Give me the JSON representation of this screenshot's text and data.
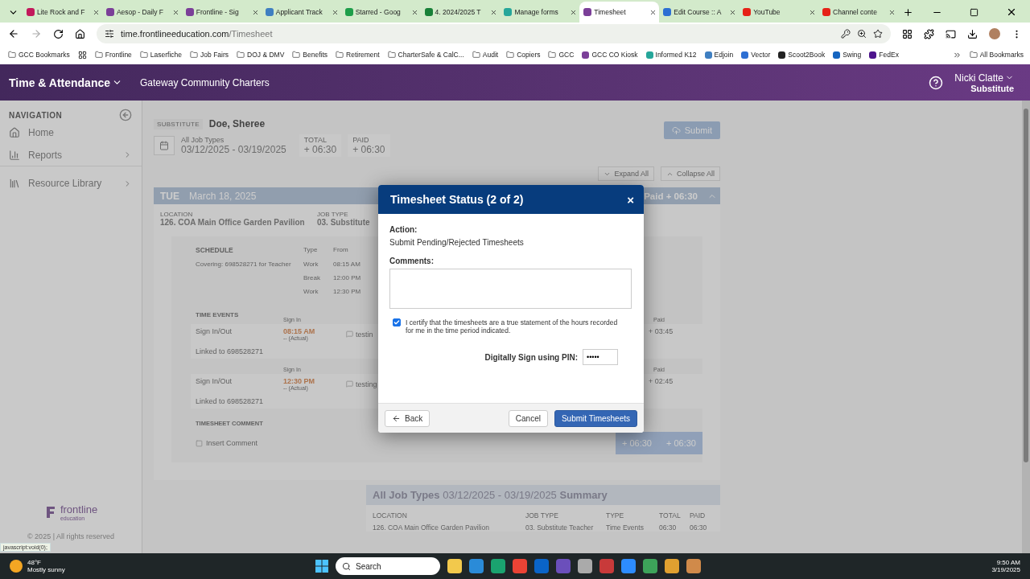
{
  "browser": {
    "tabs": [
      {
        "title": "Lite Rock and F",
        "color": "#c2185b",
        "selected": false
      },
      {
        "title": "Aesop - Daily F",
        "color": "#7b3f98",
        "selected": false
      },
      {
        "title": "Frontline - Sig",
        "color": "#7b3f98",
        "selected": false
      },
      {
        "title": "Applicant Track",
        "color": "#3f7fc1",
        "selected": false
      },
      {
        "title": "Starred - Goog",
        "color": "#1e9e4a",
        "selected": false
      },
      {
        "title": "4. 2024/2025 T",
        "color": "#188038",
        "selected": false
      },
      {
        "title": "Manage forms",
        "color": "#26a69a",
        "selected": false
      },
      {
        "title": "Timesheet",
        "color": "#7b3f98",
        "selected": true
      },
      {
        "title": "Edit Course :: A",
        "color": "#2d6fd3",
        "selected": false
      },
      {
        "title": "YouTube",
        "color": "#e62117",
        "selected": false
      },
      {
        "title": "Channel conte",
        "color": "#e62117",
        "selected": false
      }
    ],
    "url_host": "time.frontlineeducation.com",
    "url_path": "/Timesheet",
    "bookmarks": [
      {
        "label": "GCC Bookmarks",
        "kind": "folder"
      },
      {
        "label": "Frontline",
        "kind": "folder"
      },
      {
        "label": "Laserfiche",
        "kind": "folder"
      },
      {
        "label": "Job Fairs",
        "kind": "folder"
      },
      {
        "label": "DOJ & DMV",
        "kind": "folder"
      },
      {
        "label": "Benefits",
        "kind": "folder"
      },
      {
        "label": "Retirement",
        "kind": "folder"
      },
      {
        "label": "CharterSafe & CalC...",
        "kind": "folder"
      },
      {
        "label": "Audit",
        "kind": "folder"
      },
      {
        "label": "Copiers",
        "kind": "folder"
      },
      {
        "label": "GCC",
        "kind": "folder"
      },
      {
        "label": "GCC CO Kiosk",
        "kind": "site",
        "color": "#7b3f98"
      },
      {
        "label": "Informed K12",
        "kind": "site",
        "color": "#26a69a"
      },
      {
        "label": "Edjoin",
        "kind": "site",
        "color": "#3f7fc1"
      },
      {
        "label": "Vector",
        "kind": "site",
        "color": "#2d6fd3"
      },
      {
        "label": "Scoot2Book",
        "kind": "site",
        "color": "#222222"
      },
      {
        "label": "Swing",
        "kind": "site",
        "color": "#1565c0"
      },
      {
        "label": "FedEx",
        "kind": "site",
        "color": "#4d148c"
      }
    ],
    "all_bookmarks": "All Bookmarks"
  },
  "app": {
    "title": "Time & Attendance",
    "organization": "Gateway Community Charters",
    "user_name": "Nicki Clatte",
    "user_role": "Substitute"
  },
  "sidebar": {
    "heading": "NAVIGATION",
    "items": [
      {
        "label": "Home",
        "kind": "home",
        "has_children": false
      },
      {
        "label": "Reports",
        "kind": "reports",
        "has_children": true
      },
      {
        "label": "Resource Library",
        "kind": "library",
        "has_children": true
      }
    ],
    "logo": "frontline",
    "logo_sub": "education",
    "copyright": "© 2025 | All rights reserved"
  },
  "timesheet": {
    "substitute_label": "SUBSTITUTE",
    "name": "Doe, Sheree",
    "job_types": "All Job Types",
    "range": "03/12/2025 - 03/19/2025",
    "total_label": "TOTAL",
    "total": "+ 06:30",
    "paid_label": "PAID",
    "paid": "+ 06:30",
    "submit": "Submit",
    "expand": "Expand All",
    "collapse": "Collapse All",
    "day": {
      "weekday": "TUE",
      "date": "March 18, 2025",
      "paid": "Paid + 06:30",
      "location_label": "LOCATION",
      "location": "126. COA Main Office Garden Pavilion",
      "job_type_label": "JOB TYPE",
      "job_type": "03. Substitute"
    },
    "schedule": {
      "heading": "SCHEDULE",
      "type_label": "Type",
      "from_label": "From",
      "description": "Covering: 698528271 for Teacher",
      "rows": [
        {
          "type": "Work",
          "from": "08:15 AM"
        },
        {
          "type": "Break",
          "from": "12:00 PM"
        },
        {
          "type": "Work",
          "from": "12:30 PM"
        }
      ]
    },
    "events_heading": "TIME EVENTS",
    "events": [
      {
        "sign_in_label": "Sign In",
        "label": "Sign In/Out",
        "time": "08:15 AM",
        "note": "-- (Actual)",
        "comment": "testin",
        "paid_label": "Paid",
        "paid": "+ 03:45",
        "linked": "Linked to 698528271"
      },
      {
        "sign_in_label": "Sign In",
        "label": "Sign In/Out",
        "time": "12:30 PM",
        "note": "-- (Actual)",
        "comment": "testing",
        "paid_label": "Paid",
        "paid": "+ 02:45",
        "linked": "Linked to 698528271"
      }
    ],
    "comment_heading": "TIMESHEET COMMENT",
    "insert_comment": "Insert Comment",
    "day_totals": [
      "+ 06:30",
      "+ 06:30"
    ],
    "summary": {
      "title": "**All Job Types** 03/12/2025 - 03/19/2025 **Summary**",
      "columns": [
        "LOCATION",
        "JOB TYPE",
        "TYPE",
        "TOTAL",
        "PAID"
      ],
      "row": [
        "126. COA Main Office Garden Pavilion",
        "03. Substitute Teacher",
        "Time Events",
        "06:30",
        "06:30"
      ]
    }
  },
  "modal": {
    "title": "Timesheet Status (2 of 2)",
    "close": "×",
    "action_label": "Action:",
    "action": "Submit Pending/Rejected Timesheets",
    "comments_label": "Comments:",
    "certify": {
      "checked": true,
      "text": "I certify that the timesheets are a true statement of the hours recorded for me in the time period indicated."
    },
    "pin_label": "Digitally Sign using PIN:",
    "pin": "•••••",
    "back": "Back",
    "cancel": "Cancel",
    "submit": "Submit Timesheets"
  },
  "status_link": "javascript:void(0);",
  "taskbar": {
    "temperature": "48°F",
    "weather": "Mostly sunny",
    "search": "Search",
    "time": "9:50 AM",
    "date": "3/19/2025"
  }
}
